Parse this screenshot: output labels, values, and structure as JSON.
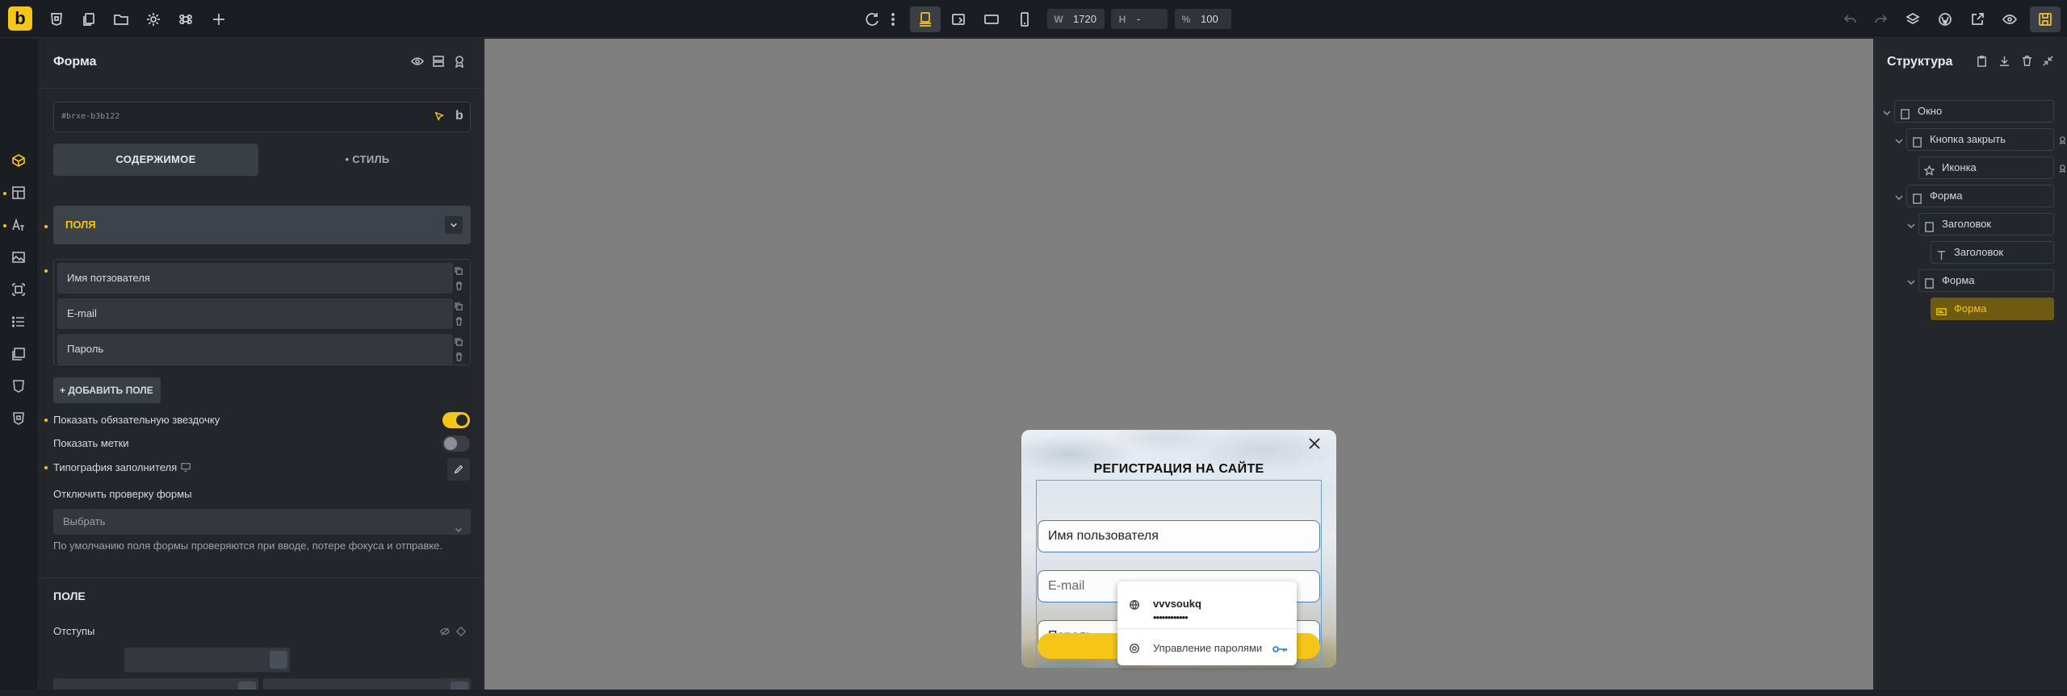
{
  "topbar": {
    "logo": "b",
    "width_label": "W",
    "width_value": "1720",
    "height_label": "H",
    "height_value": "-",
    "zoom_label": "%",
    "zoom_value": "100"
  },
  "panel": {
    "title": "Форма",
    "element_id": "#brxe-b3b122",
    "tab_content": "СОДЕРЖИМОЕ",
    "tab_style": "• СТИЛЬ",
    "section_fields": "Поля",
    "fields": [
      {
        "label": "Имя потзователя"
      },
      {
        "label": "E-mail"
      },
      {
        "label": "Пароль"
      }
    ],
    "add_field": "+ ДОБАВИТЬ ПОЛЕ",
    "opt_required_star": "Показать обязательную звездочку",
    "opt_show_labels": "Показать метки",
    "opt_placeholder_typography": "Типография заполнителя",
    "opt_disable_validation": "Отключить проверку формы",
    "select_placeholder": "Выбрать",
    "hint": "По умолчанию поля формы проверяются при вводе, потере фокуса и отправке.",
    "section_field": "ПОЛЕ",
    "section_padding": "Отступы"
  },
  "modal": {
    "title": "РЕГИСТРАЦИЯ НА САЙТЕ",
    "input_username": "Имя пользователя",
    "input_email": "E-mail",
    "input_password": "Пароль"
  },
  "password_popup": {
    "username": "vvvsoukq",
    "password_mask": "••••••••••••",
    "manage": "Управление паролями"
  },
  "structure": {
    "title": "Структура",
    "items": [
      {
        "label": "Окно"
      },
      {
        "label": "Кнопка закрыть"
      },
      {
        "label": "Иконка"
      },
      {
        "label": "Форма"
      },
      {
        "label": "Заголовок"
      },
      {
        "label": "Заголовок"
      },
      {
        "label": "Форма"
      },
      {
        "label": "Форма"
      }
    ]
  },
  "colors": {
    "accent": "#f5c518",
    "canvas": "#7f7f7f",
    "panel": "#23262b"
  }
}
